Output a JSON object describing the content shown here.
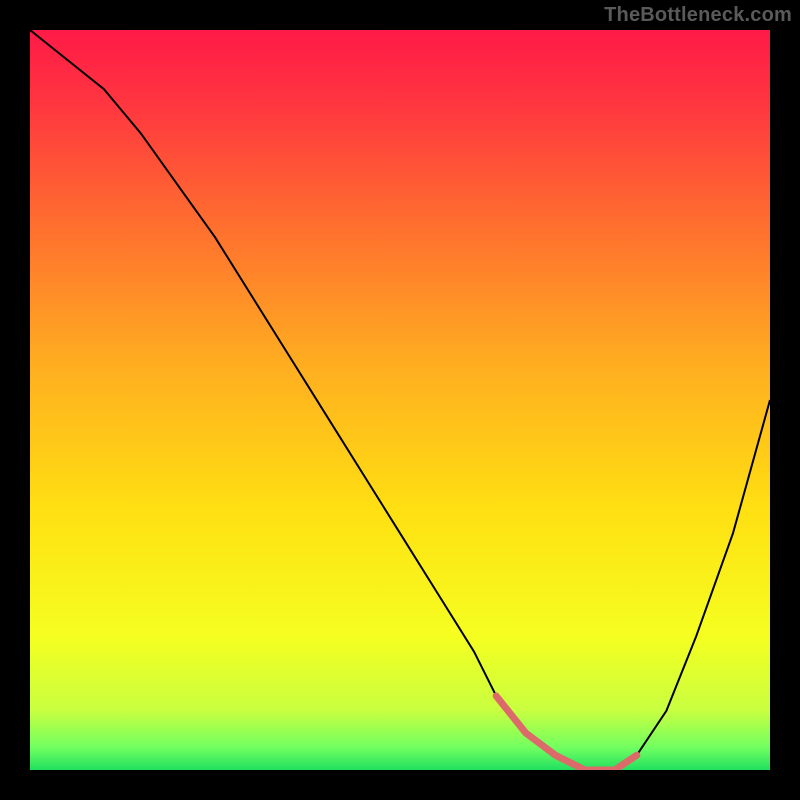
{
  "watermark": "TheBottleneck.com",
  "chart_data": {
    "type": "line",
    "title": "",
    "xlabel": "",
    "ylabel": "",
    "xlim": [
      0,
      100
    ],
    "ylim": [
      0,
      100
    ],
    "grid": false,
    "series": [
      {
        "name": "curve",
        "color": "#000000",
        "stroke_width": 2,
        "x": [
          0,
          5,
          10,
          15,
          20,
          25,
          30,
          35,
          40,
          45,
          50,
          55,
          60,
          63,
          67,
          71,
          75,
          79,
          82,
          86,
          90,
          95,
          100
        ],
        "values": [
          100,
          96,
          92,
          86,
          79,
          72,
          64,
          56,
          48,
          40,
          32,
          24,
          16,
          10,
          5,
          2,
          0,
          0,
          2,
          8,
          18,
          32,
          50
        ]
      },
      {
        "name": "highlight",
        "color": "#dd6a6a",
        "stroke_width": 7,
        "x": [
          63,
          67,
          71,
          75,
          79,
          82
        ],
        "values": [
          10,
          5,
          2,
          0,
          0,
          2
        ]
      }
    ],
    "background_gradient": {
      "stops": [
        {
          "offset": 0.0,
          "color": "#ff1a47"
        },
        {
          "offset": 0.1,
          "color": "#ff3640"
        },
        {
          "offset": 0.25,
          "color": "#ff6a30"
        },
        {
          "offset": 0.45,
          "color": "#ffad20"
        },
        {
          "offset": 0.65,
          "color": "#ffe012"
        },
        {
          "offset": 0.82,
          "color": "#f5ff20"
        },
        {
          "offset": 0.92,
          "color": "#c8ff40"
        },
        {
          "offset": 0.97,
          "color": "#70ff60"
        },
        {
          "offset": 1.0,
          "color": "#20e060"
        }
      ]
    }
  }
}
